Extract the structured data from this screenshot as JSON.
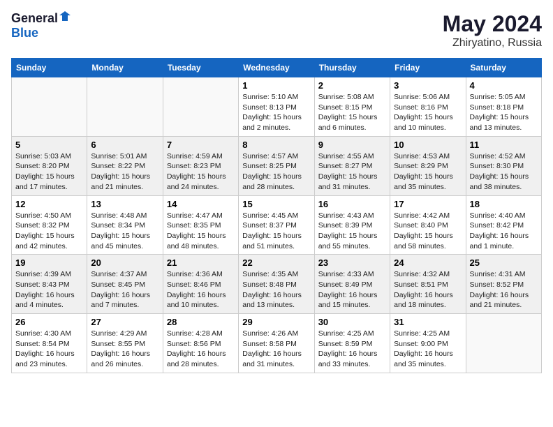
{
  "logo": {
    "general": "General",
    "blue": "Blue"
  },
  "title": "May 2024",
  "location": "Zhiryatino, Russia",
  "days_of_week": [
    "Sunday",
    "Monday",
    "Tuesday",
    "Wednesday",
    "Thursday",
    "Friday",
    "Saturday"
  ],
  "weeks": [
    [
      {
        "day": "",
        "info": ""
      },
      {
        "day": "",
        "info": ""
      },
      {
        "day": "",
        "info": ""
      },
      {
        "day": "1",
        "info": "Sunrise: 5:10 AM\nSunset: 8:13 PM\nDaylight: 15 hours\nand 2 minutes."
      },
      {
        "day": "2",
        "info": "Sunrise: 5:08 AM\nSunset: 8:15 PM\nDaylight: 15 hours\nand 6 minutes."
      },
      {
        "day": "3",
        "info": "Sunrise: 5:06 AM\nSunset: 8:16 PM\nDaylight: 15 hours\nand 10 minutes."
      },
      {
        "day": "4",
        "info": "Sunrise: 5:05 AM\nSunset: 8:18 PM\nDaylight: 15 hours\nand 13 minutes."
      }
    ],
    [
      {
        "day": "5",
        "info": "Sunrise: 5:03 AM\nSunset: 8:20 PM\nDaylight: 15 hours\nand 17 minutes."
      },
      {
        "day": "6",
        "info": "Sunrise: 5:01 AM\nSunset: 8:22 PM\nDaylight: 15 hours\nand 21 minutes."
      },
      {
        "day": "7",
        "info": "Sunrise: 4:59 AM\nSunset: 8:23 PM\nDaylight: 15 hours\nand 24 minutes."
      },
      {
        "day": "8",
        "info": "Sunrise: 4:57 AM\nSunset: 8:25 PM\nDaylight: 15 hours\nand 28 minutes."
      },
      {
        "day": "9",
        "info": "Sunrise: 4:55 AM\nSunset: 8:27 PM\nDaylight: 15 hours\nand 31 minutes."
      },
      {
        "day": "10",
        "info": "Sunrise: 4:53 AM\nSunset: 8:29 PM\nDaylight: 15 hours\nand 35 minutes."
      },
      {
        "day": "11",
        "info": "Sunrise: 4:52 AM\nSunset: 8:30 PM\nDaylight: 15 hours\nand 38 minutes."
      }
    ],
    [
      {
        "day": "12",
        "info": "Sunrise: 4:50 AM\nSunset: 8:32 PM\nDaylight: 15 hours\nand 42 minutes."
      },
      {
        "day": "13",
        "info": "Sunrise: 4:48 AM\nSunset: 8:34 PM\nDaylight: 15 hours\nand 45 minutes."
      },
      {
        "day": "14",
        "info": "Sunrise: 4:47 AM\nSunset: 8:35 PM\nDaylight: 15 hours\nand 48 minutes."
      },
      {
        "day": "15",
        "info": "Sunrise: 4:45 AM\nSunset: 8:37 PM\nDaylight: 15 hours\nand 51 minutes."
      },
      {
        "day": "16",
        "info": "Sunrise: 4:43 AM\nSunset: 8:39 PM\nDaylight: 15 hours\nand 55 minutes."
      },
      {
        "day": "17",
        "info": "Sunrise: 4:42 AM\nSunset: 8:40 PM\nDaylight: 15 hours\nand 58 minutes."
      },
      {
        "day": "18",
        "info": "Sunrise: 4:40 AM\nSunset: 8:42 PM\nDaylight: 16 hours\nand 1 minute."
      }
    ],
    [
      {
        "day": "19",
        "info": "Sunrise: 4:39 AM\nSunset: 8:43 PM\nDaylight: 16 hours\nand 4 minutes."
      },
      {
        "day": "20",
        "info": "Sunrise: 4:37 AM\nSunset: 8:45 PM\nDaylight: 16 hours\nand 7 minutes."
      },
      {
        "day": "21",
        "info": "Sunrise: 4:36 AM\nSunset: 8:46 PM\nDaylight: 16 hours\nand 10 minutes."
      },
      {
        "day": "22",
        "info": "Sunrise: 4:35 AM\nSunset: 8:48 PM\nDaylight: 16 hours\nand 13 minutes."
      },
      {
        "day": "23",
        "info": "Sunrise: 4:33 AM\nSunset: 8:49 PM\nDaylight: 16 hours\nand 15 minutes."
      },
      {
        "day": "24",
        "info": "Sunrise: 4:32 AM\nSunset: 8:51 PM\nDaylight: 16 hours\nand 18 minutes."
      },
      {
        "day": "25",
        "info": "Sunrise: 4:31 AM\nSunset: 8:52 PM\nDaylight: 16 hours\nand 21 minutes."
      }
    ],
    [
      {
        "day": "26",
        "info": "Sunrise: 4:30 AM\nSunset: 8:54 PM\nDaylight: 16 hours\nand 23 minutes."
      },
      {
        "day": "27",
        "info": "Sunrise: 4:29 AM\nSunset: 8:55 PM\nDaylight: 16 hours\nand 26 minutes."
      },
      {
        "day": "28",
        "info": "Sunrise: 4:28 AM\nSunset: 8:56 PM\nDaylight: 16 hours\nand 28 minutes."
      },
      {
        "day": "29",
        "info": "Sunrise: 4:26 AM\nSunset: 8:58 PM\nDaylight: 16 hours\nand 31 minutes."
      },
      {
        "day": "30",
        "info": "Sunrise: 4:25 AM\nSunset: 8:59 PM\nDaylight: 16 hours\nand 33 minutes."
      },
      {
        "day": "31",
        "info": "Sunrise: 4:25 AM\nSunset: 9:00 PM\nDaylight: 16 hours\nand 35 minutes."
      },
      {
        "day": "",
        "info": ""
      }
    ]
  ]
}
